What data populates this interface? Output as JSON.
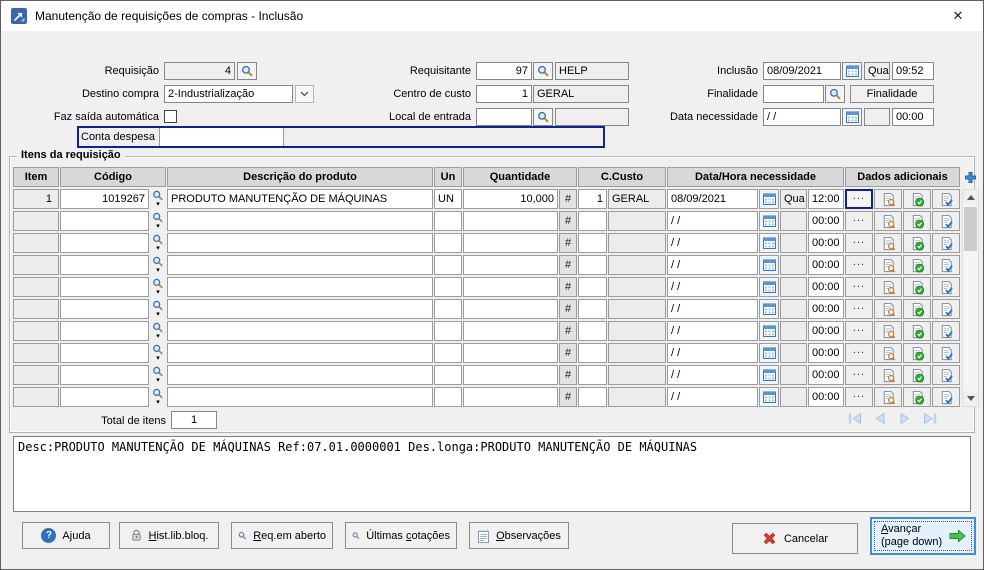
{
  "window": {
    "title": "Manutenção de requisições de compras - Inclusão",
    "close_glyph": "✕"
  },
  "colors": {
    "focus_navy": "#112191",
    "header_gray": "#d8d8d8",
    "highlight_blue": "#e3f1fc",
    "accent_blue": "#3d8fd1"
  },
  "form": {
    "requisicao": {
      "label": "Requisição",
      "value": "4"
    },
    "destino_compra": {
      "label": "Destino compra",
      "value": "2-Industrialização"
    },
    "faz_saida": {
      "label": "Faz saída automática"
    },
    "conta_despesa": {
      "label": "Conta despesa",
      "value": ""
    },
    "requisitante": {
      "label": "Requisitante",
      "code": "97",
      "name": "HELP"
    },
    "centro_custo": {
      "label": "Centro de custo",
      "code": "1",
      "name": "GERAL"
    },
    "local_entrada": {
      "label": "Local de entrada",
      "code": "",
      "name": ""
    },
    "inclusao": {
      "label": "Inclusão",
      "date": "08/09/2021",
      "day": "Qua",
      "time": "09:52"
    },
    "finalidade": {
      "label": "Finalidade",
      "value": "",
      "button": "Finalidade"
    },
    "data_necessidade": {
      "label": "Data necessidade",
      "date": "/ /",
      "day": "",
      "time": "00:00"
    }
  },
  "grid": {
    "group_title": "Itens da requisição",
    "headers": {
      "item": "Item",
      "codigo": "Código",
      "descricao": "Descrição do produto",
      "un": "Un",
      "quantidade": "Quantidade",
      "ccusto": "C.Custo",
      "data_hora": "Data/Hora necessidade",
      "dados": "Dados adicionais"
    },
    "hash_button": "#",
    "more_button": "...",
    "dropdown_arrow": "▾",
    "rows": [
      {
        "item": "1",
        "codigo": "1019267",
        "descricao": "PRODUTO MANUTENÇÃO DE MÁQUINAS",
        "un": "UN",
        "quantidade": "10,000",
        "ccusto_num": "1",
        "ccusto_nome": "GERAL",
        "data": "08/09/2021",
        "dia": "Qua",
        "hora": "12:00"
      },
      {
        "item": "",
        "codigo": "",
        "descricao": "",
        "un": "",
        "quantidade": "",
        "ccusto_num": "",
        "ccusto_nome": "",
        "data": "/ /",
        "dia": "",
        "hora": "00:00"
      },
      {
        "item": "",
        "codigo": "",
        "descricao": "",
        "un": "",
        "quantidade": "",
        "ccusto_num": "",
        "ccusto_nome": "",
        "data": "/ /",
        "dia": "",
        "hora": "00:00"
      },
      {
        "item": "",
        "codigo": "",
        "descricao": "",
        "un": "",
        "quantidade": "",
        "ccusto_num": "",
        "ccusto_nome": "",
        "data": "/ /",
        "dia": "",
        "hora": "00:00"
      },
      {
        "item": "",
        "codigo": "",
        "descricao": "",
        "un": "",
        "quantidade": "",
        "ccusto_num": "",
        "ccusto_nome": "",
        "data": "/ /",
        "dia": "",
        "hora": "00:00"
      },
      {
        "item": "",
        "codigo": "",
        "descricao": "",
        "un": "",
        "quantidade": "",
        "ccusto_num": "",
        "ccusto_nome": "",
        "data": "/ /",
        "dia": "",
        "hora": "00:00"
      },
      {
        "item": "",
        "codigo": "",
        "descricao": "",
        "un": "",
        "quantidade": "",
        "ccusto_num": "",
        "ccusto_nome": "",
        "data": "/ /",
        "dia": "",
        "hora": "00:00"
      },
      {
        "item": "",
        "codigo": "",
        "descricao": "",
        "un": "",
        "quantidade": "",
        "ccusto_num": "",
        "ccusto_nome": "",
        "data": "/ /",
        "dia": "",
        "hora": "00:00"
      },
      {
        "item": "",
        "codigo": "",
        "descricao": "",
        "un": "",
        "quantidade": "",
        "ccusto_num": "",
        "ccusto_nome": "",
        "data": "/ /",
        "dia": "",
        "hora": "00:00"
      },
      {
        "item": "",
        "codigo": "",
        "descricao": "",
        "un": "",
        "quantidade": "",
        "ccusto_num": "",
        "ccusto_nome": "",
        "data": "/ /",
        "dia": "",
        "hora": "00:00"
      }
    ],
    "total_label": "Total de itens",
    "total_value": "1"
  },
  "description": "Desc:PRODUTO MANUTENÇÃO DE MÁQUINAS Ref:07.01.0000001 Des.longa:PRODUTO MANUTENÇÃO DE MÁQUINAS",
  "footer": {
    "ajuda": {
      "pre": "A",
      "u": "j",
      "post": "uda"
    },
    "hist": {
      "pre": "",
      "u": "H",
      "post": "ist.lib.bloq."
    },
    "req": {
      "pre": "",
      "u": "R",
      "post": "eq.em aberto"
    },
    "cotacoes": {
      "pre": "Últimas ",
      "u": "c",
      "post": "otações"
    },
    "obs": {
      "pre": "",
      "u": "O",
      "post": "bservações"
    },
    "cancelar": "Cancelar",
    "avancar": {
      "pre": "",
      "u": "A",
      "post": "vançar"
    },
    "avancar2": "(page down)",
    "help_glyph": "?"
  }
}
